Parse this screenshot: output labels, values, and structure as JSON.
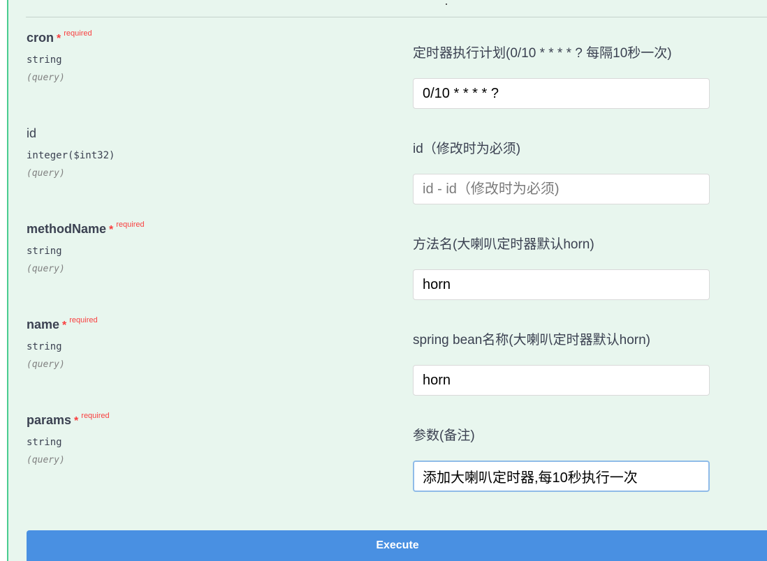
{
  "params": [
    {
      "name": "cron",
      "required": true,
      "required_label": "required",
      "type": "string",
      "in": "(query)",
      "description": "定时器执行计划(0/10 * * * * ? 每隔10秒一次)",
      "value": "0/10 * * * * ?",
      "placeholder": ""
    },
    {
      "name": "id",
      "required": false,
      "required_label": "",
      "type": "integer($int32)",
      "in": "(query)",
      "description": "id（修改时为必须)",
      "value": "",
      "placeholder": "id - id（修改时为必须)"
    },
    {
      "name": "methodName",
      "required": true,
      "required_label": "required",
      "type": "string",
      "in": "(query)",
      "description": "方法名(大喇叭定时器默认horn)",
      "value": "horn",
      "placeholder": ""
    },
    {
      "name": "name",
      "required": true,
      "required_label": "required",
      "type": "string",
      "in": "(query)",
      "description": "spring bean名称(大喇叭定时器默认horn)",
      "value": "horn",
      "placeholder": ""
    },
    {
      "name": "params",
      "required": true,
      "required_label": "required",
      "type": "string",
      "in": "(query)",
      "description": "参数(备注)",
      "value": "添加大喇叭定时器,每10秒执行一次",
      "placeholder": ""
    }
  ],
  "execute_label": "Execute",
  "colors": {
    "panel_bg": "#e8f6ee",
    "accent": "#49cc90",
    "required": "#f93e3e",
    "execute_bg": "#4990e2"
  }
}
